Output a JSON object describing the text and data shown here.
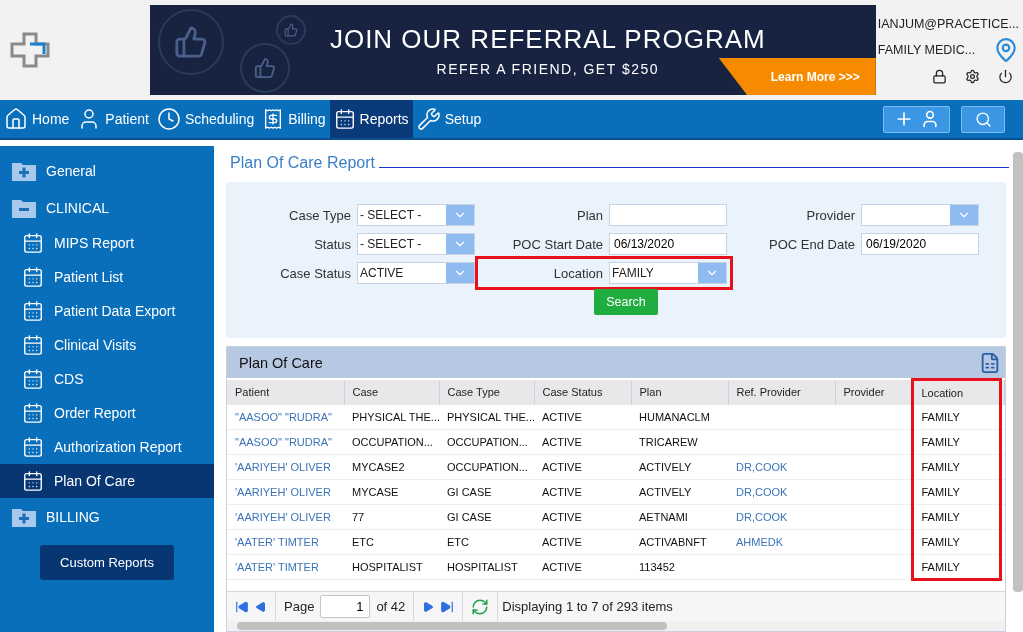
{
  "header": {
    "banner": {
      "title": "JOIN OUR REFERRAL PROGRAM",
      "subtitle": "REFER A FRIEND, GET $250",
      "cta": "Learn More >>>"
    },
    "user": "IANJUM@PRACETICE...",
    "practice": "FAMILY MEDIC..."
  },
  "nav": {
    "items": [
      {
        "label": "Home",
        "selected": false
      },
      {
        "label": "Patient",
        "selected": false
      },
      {
        "label": "Scheduling",
        "selected": false
      },
      {
        "label": "Billing",
        "selected": false
      },
      {
        "label": "Reports",
        "selected": true
      },
      {
        "label": "Setup",
        "selected": false
      }
    ]
  },
  "sidebar": {
    "groups": [
      {
        "label": "General",
        "expanded": false
      },
      {
        "label": "CLINICAL",
        "expanded": true,
        "children": [
          {
            "label": "MIPS Report",
            "selected": false
          },
          {
            "label": "Patient List",
            "selected": false
          },
          {
            "label": "Patient Data Export",
            "selected": false
          },
          {
            "label": "Clinical Visits",
            "selected": false
          },
          {
            "label": "CDS",
            "selected": false
          },
          {
            "label": "Order Report",
            "selected": false
          },
          {
            "label": "Authorization Report",
            "selected": false
          },
          {
            "label": "Plan Of Care",
            "selected": true
          }
        ]
      },
      {
        "label": "BILLING",
        "expanded": false
      }
    ],
    "button": "Custom Reports"
  },
  "report": {
    "title": "Plan Of Care Report",
    "fields": [
      {
        "label": "Case Type",
        "kind": "select",
        "value": "- SELECT -",
        "highlighted": false
      },
      {
        "label": "Plan",
        "kind": "input",
        "highlighted": false
      },
      {
        "label": "Provider",
        "kind": "select",
        "highlighted": false
      },
      {
        "label": "Status",
        "kind": "select",
        "value": "- SELECT -",
        "highlighted": false
      },
      {
        "label": "POC Start Date",
        "kind": "input",
        "value": "06/13/2020",
        "highlighted": false
      },
      {
        "label": "POC End Date",
        "kind": "input",
        "value": "06/19/2020",
        "highlighted": false
      },
      {
        "label": "Case Status",
        "kind": "select",
        "value": "ACTIVE",
        "highlighted": false
      },
      {
        "label": "Location",
        "kind": "select",
        "value": "FAMILY",
        "highlighted": true
      }
    ],
    "search_button": "Search"
  },
  "table": {
    "title": "Plan Of Care",
    "columns": [
      {
        "label": "Patient",
        "kind": "link",
        "highlighted": false
      },
      {
        "label": "Case",
        "kind": "text",
        "highlighted": false
      },
      {
        "label": "Case Type",
        "kind": "text",
        "highlighted": false
      },
      {
        "label": "Case Status",
        "kind": "text",
        "highlighted": false
      },
      {
        "label": "Plan",
        "kind": "text",
        "highlighted": false
      },
      {
        "label": "Ref. Provider",
        "kind": "link",
        "highlighted": false
      },
      {
        "label": "Provider",
        "kind": "text",
        "highlighted": false
      },
      {
        "label": "Location",
        "kind": "text",
        "highlighted": true
      }
    ],
    "rows": [
      [
        "\"AASOO\" \"RUDRA\"",
        "PHYSICAL THE...",
        "PHYSICAL THE...",
        "ACTIVE",
        "HUMANACLM",
        null,
        null,
        "FAMILY"
      ],
      [
        "\"AASOO\" \"RUDRA\"",
        "OCCUPATION...",
        "OCCUPATION...",
        "ACTIVE",
        "TRICAREW",
        null,
        null,
        "FAMILY"
      ],
      [
        "'AARIYEH' OLIVER",
        "MYCASE2",
        "OCCUPATION...",
        "ACTIVE",
        "ACTIVELY",
        "DR,COOK",
        null,
        "FAMILY"
      ],
      [
        "'AARIYEH' OLIVER",
        "MYCASE",
        "GI CASE",
        "ACTIVE",
        "ACTIVELY",
        "DR,COOK",
        null,
        "FAMILY"
      ],
      [
        "'AARIYEH' OLIVER",
        "77",
        "GI CASE",
        "ACTIVE",
        "AETNAMI",
        "DR,COOK",
        null,
        "FAMILY"
      ],
      [
        "'AATER' TIMTER",
        "ETC",
        "ETC",
        "ACTIVE",
        "ACTIVABNFT",
        "AHMEDK",
        null,
        "FAMILY"
      ],
      [
        "'AATER' TIMTER",
        "HOSPITALIST",
        "HOSPITALIST",
        "ACTIVE",
        "113452",
        null,
        null,
        "FAMILY"
      ]
    ],
    "pager": {
      "page_label": "Page",
      "page": "1",
      "of": "of 42",
      "summary": "Displaying 1 to 7 of 293 items"
    }
  }
}
